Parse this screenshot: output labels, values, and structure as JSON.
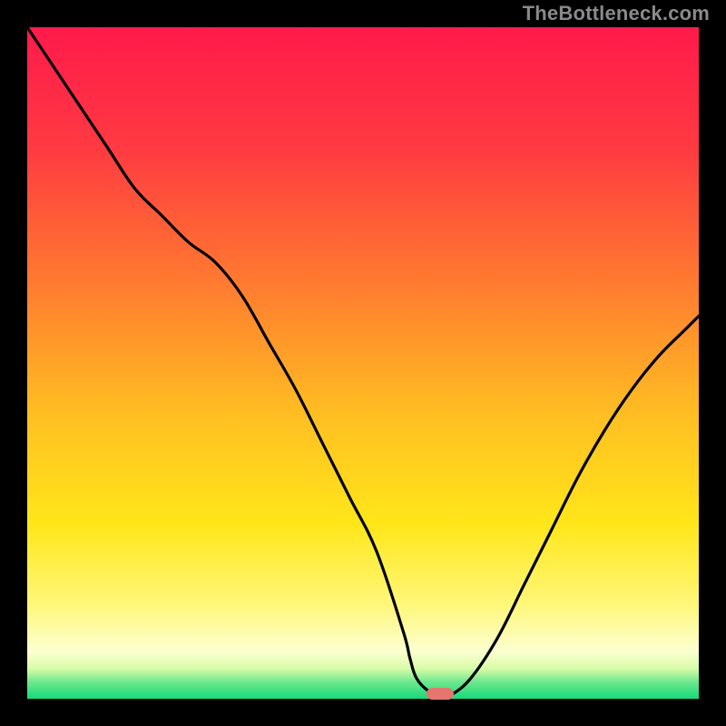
{
  "attribution": "TheBottleneck.com",
  "colors": {
    "frame": "#000000",
    "gradient_stops": [
      {
        "offset": 0.0,
        "color": "#ff1a4b"
      },
      {
        "offset": 0.18,
        "color": "#ff3a42"
      },
      {
        "offset": 0.38,
        "color": "#ff7a30"
      },
      {
        "offset": 0.58,
        "color": "#ffbf22"
      },
      {
        "offset": 0.74,
        "color": "#ffe61a"
      },
      {
        "offset": 0.86,
        "color": "#fff77a"
      },
      {
        "offset": 0.93,
        "color": "#fbffd0"
      },
      {
        "offset": 0.955,
        "color": "#d8fca8"
      },
      {
        "offset": 0.975,
        "color": "#6de88e"
      },
      {
        "offset": 1.0,
        "color": "#17d97a"
      }
    ],
    "curve": "#000000",
    "marker": "#e4766f"
  },
  "chart_data": {
    "type": "line",
    "title": "",
    "xlabel": "",
    "ylabel": "",
    "xlim": [
      0,
      100
    ],
    "ylim": [
      0,
      100
    ],
    "grid": false,
    "legend": false,
    "series": [
      {
        "name": "bottleneck-curve",
        "x": [
          0,
          4,
          8,
          12,
          16,
          20,
          24,
          28,
          32,
          36,
          40,
          44,
          48,
          52,
          56,
          57,
          58,
          60,
          62,
          63,
          66,
          70,
          74,
          78,
          82,
          86,
          90,
          94,
          98,
          100
        ],
        "y": [
          100,
          94,
          88,
          82,
          76,
          72,
          68,
          65,
          60,
          53,
          46,
          38,
          30,
          22,
          10,
          6,
          3,
          1,
          0.5,
          0.5,
          3,
          9,
          17,
          25,
          33,
          40,
          46,
          51,
          55,
          57
        ]
      }
    ],
    "marker": {
      "x_start": 59.5,
      "x_end": 63.5,
      "y": 0.7,
      "height_pct": 1.8
    }
  }
}
